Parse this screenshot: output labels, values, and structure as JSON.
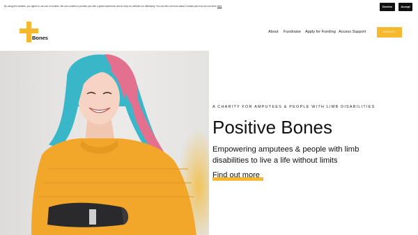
{
  "cookie_bar": {
    "text": "By using this website, you agree to our use of cookies. We use cookies to provide you with a great experience and to help our website run effectively. You can find out more about Cookies and how we use them",
    "link": "here",
    "decline_label": "Decline",
    "accept_label": "Accept"
  },
  "header": {
    "logo_text": "Bones",
    "nav": [
      "About",
      "Fundraise",
      "Apply for Funding",
      "Access Support"
    ],
    "donate_label": "DONATE"
  },
  "hero": {
    "eyebrow": "A CHARITY FOR AMPUTEES & PEOPLE WITH LIMB DISABILITIES",
    "title": "Positive Bones",
    "subtitle": "Empowering amputees & people with limb disabilities to live a life without limits",
    "cta": "Find out more"
  },
  "colors": {
    "brand_yellow": "#f5b82e",
    "sweater": "#f2a72a",
    "hair_blue": "#39b7c9",
    "hair_pink": "#e2708e"
  }
}
